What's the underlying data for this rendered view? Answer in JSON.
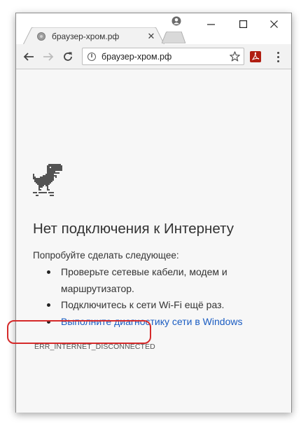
{
  "tab": {
    "title": "браузер-хром.рф",
    "close_label": "✕"
  },
  "window_controls": {
    "minimize_label": "—",
    "maximize_label": "☐",
    "close_label": "✕"
  },
  "toolbar": {
    "url": "браузер-хром.рф"
  },
  "error_page": {
    "title": "Нет подключения к Интернету",
    "suggestions_intro": "Попробуйте сделать следующее:",
    "suggestions": [
      "Проверьте сетевые кабели, модем и маршрутизатор.",
      "Подключитесь к сети Wi-Fi ещё раз."
    ],
    "diagnostics_link": "Выполните диагностику сети в Windows",
    "error_code": "ERR_INTERNET_DISCONNECTED"
  },
  "icons": [
    "back-arrow-icon",
    "forward-arrow-icon",
    "reload-icon",
    "info-icon",
    "star-icon",
    "pdf-extension-icon",
    "menu-icon",
    "profile-icon",
    "dino-icon"
  ],
  "colors": {
    "link": "#1a5cc2",
    "highlight": "#d52a2a",
    "content_bg": "#f7f7f7",
    "toolbar_bg": "#f2f2f2"
  }
}
